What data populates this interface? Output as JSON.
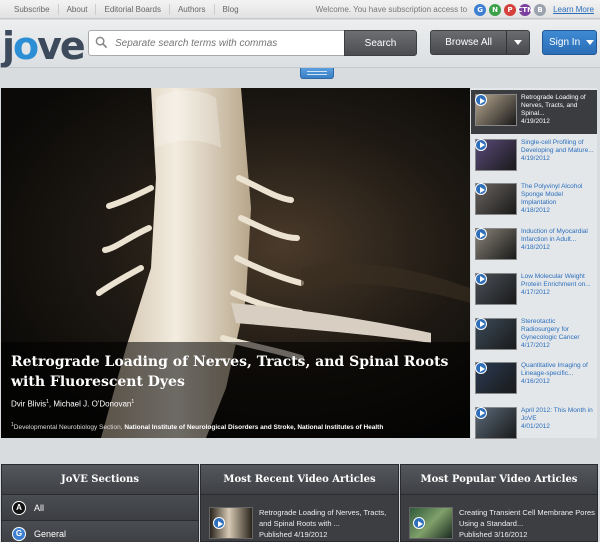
{
  "topnav": [
    "Subscribe",
    "About",
    "Editorial Boards",
    "Authors",
    "Blog"
  ],
  "subscription": {
    "welcome": "Welcome. You have subscription access to",
    "badges": [
      {
        "label": "G",
        "color": "#3d7fd1"
      },
      {
        "label": "N",
        "color": "#3aa04a"
      },
      {
        "label": "P",
        "color": "#d6403a"
      },
      {
        "label": "CTN",
        "color": "#7b3fa0"
      },
      {
        "label": "B",
        "color": "#9aa3ad"
      }
    ],
    "learn_more": "Learn More"
  },
  "header": {
    "logo_j": "j",
    "logo_o": "o",
    "logo_rest": "ve",
    "search_placeholder": "Separate search terms with commas",
    "search_button": "Search",
    "browse_label": "Browse All",
    "signin_label": "Sign In"
  },
  "hero": {
    "title": "Retrograde Loading of Nerves, Tracts, and Spinal Roots with Fluorescent Dyes",
    "author1": "Dvir Blivis",
    "author1_sup": "1",
    "author2": "Michael J. O'Donovan",
    "author2_sup": "1",
    "aff_sup": "1",
    "aff_dept": "Developmental Neurobiology Section, ",
    "aff_inst": "National Institute of Neurological Disorders and Stroke, National Institutes of Health"
  },
  "side_items": [
    {
      "title": "Retrograde Loading of Nerves, Tracts, and Spinal...",
      "date": "4/19/2012",
      "active": true,
      "thumb": "#b8a890"
    },
    {
      "title": "Single-cell Profiling of Developing and Mature...",
      "date": "4/19/2012",
      "active": false,
      "thumb": "#5a4a7a"
    },
    {
      "title": "The Polyvinyl Alcohol Sponge Model Implantation",
      "date": "4/18/2012",
      "active": false,
      "thumb": "#6a6460"
    },
    {
      "title": "Induction of Myocardial Infarction in Adult...",
      "date": "4/18/2012",
      "active": false,
      "thumb": "#8a8478"
    },
    {
      "title": "Low Molecular Weight Protein Enrichment on...",
      "date": "4/17/2012",
      "active": false,
      "thumb": "#4a5058"
    },
    {
      "title": "Stereotactic Radiosurgery for Gynecologic Cancer",
      "date": "4/17/2012",
      "active": false,
      "thumb": "#3a4a58"
    },
    {
      "title": "Quantitative Imaging of Lineage-specific...",
      "date": "4/16/2012",
      "active": false,
      "thumb": "#2a3a52"
    },
    {
      "title": "April 2012: This Month in JoVE",
      "date": "4/01/2012",
      "active": false,
      "thumb": "#5a6a7a"
    }
  ],
  "panels": {
    "sections_title": "JoVE Sections",
    "recent_title": "Most Recent Video Articles",
    "popular_title": "Most Popular Video Articles",
    "sections": [
      {
        "letter": "A",
        "label": "All",
        "bg": "#111111",
        "fg": "#ffffff"
      },
      {
        "letter": "G",
        "label": "General",
        "bg": "#3d7fd1",
        "fg": "#ffffff"
      }
    ],
    "recent": {
      "title": "Retrograde Loading of Nerves, Tracts, and Spinal Roots with ...",
      "published": "Published 4/19/2012"
    },
    "popular": {
      "title": "Creating Transient Cell Membrane Pores Using a Standard...",
      "published": "Published 3/16/2012"
    }
  }
}
